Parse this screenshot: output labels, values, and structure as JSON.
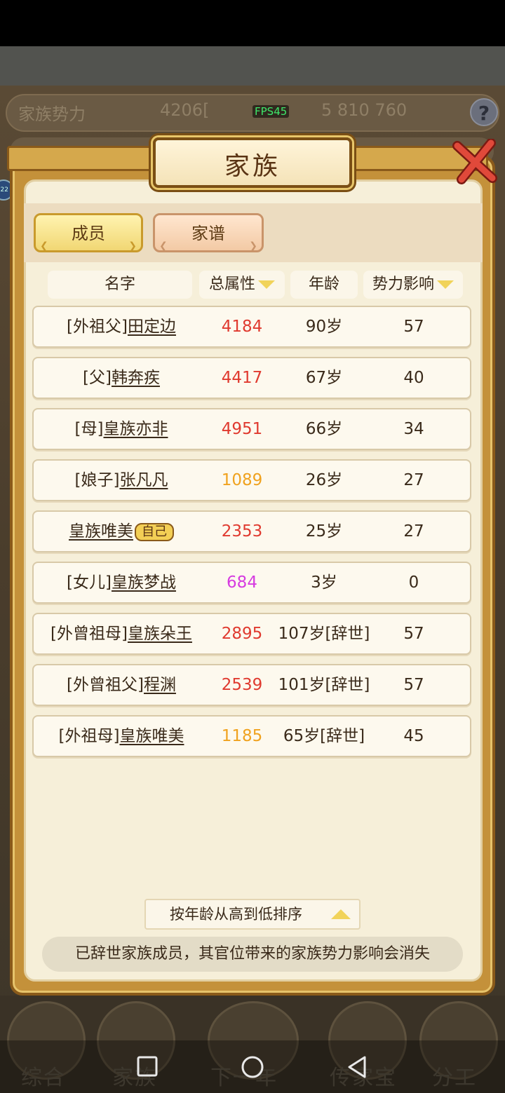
{
  "hud": {
    "title": "家族势力",
    "power": "4206[",
    "fps": "FPS45",
    "resources": "5 810 760"
  },
  "dialog": {
    "title": "家族",
    "tabs": [
      "成员",
      "家谱"
    ]
  },
  "table": {
    "headers": [
      "名字",
      "总属性",
      "年龄",
      "势力影响"
    ],
    "rows": [
      {
        "prefix": "[外祖父]",
        "name": "田定边",
        "attr": "4184",
        "attr_color": "#e03a2f",
        "age": "90岁",
        "power": "57"
      },
      {
        "prefix": "[父]",
        "name": "韩奔疾",
        "attr": "4417",
        "attr_color": "#e03a2f",
        "age": "67岁",
        "power": "40"
      },
      {
        "prefix": "[母]",
        "name": "皇族亦非",
        "attr": "4951",
        "attr_color": "#e03a2f",
        "age": "66岁",
        "power": "34"
      },
      {
        "prefix": "[娘子]",
        "name": "张凡凡",
        "attr": "1089",
        "attr_color": "#f0a21e",
        "age": "26岁",
        "power": "27"
      },
      {
        "prefix": "",
        "name": "皇族唯美",
        "self_tag": "自己",
        "attr": "2353",
        "attr_color": "#e03a2f",
        "age": "25岁",
        "power": "27"
      },
      {
        "prefix": "[女儿]",
        "name": "皇族梦战",
        "attr": "684",
        "attr_color": "#d63be0",
        "age": "3岁",
        "power": "0"
      },
      {
        "prefix": "[外曾祖母]",
        "name": "皇族朵王",
        "attr": "2895",
        "attr_color": "#e03a2f",
        "age": "107岁[辞世]",
        "power": "57"
      },
      {
        "prefix": "[外曾祖父]",
        "name": "程渊",
        "attr": "2539",
        "attr_color": "#e03a2f",
        "age": "101岁[辞世]",
        "power": "57"
      },
      {
        "prefix": "[外祖母]",
        "name": "皇族唯美",
        "attr": "1185",
        "attr_color": "#f0a21e",
        "age": "65岁[辞世]",
        "power": "45"
      }
    ]
  },
  "sort_label": "按年龄从高到低排序",
  "note": "已辞世家族成员，其官位带来的家族势力影响会消失",
  "bottom_menu": [
    "综合",
    "家族",
    "下一年",
    "传家宝",
    "分工"
  ],
  "colors": {
    "attr_red": "#e03a2f",
    "attr_orange": "#f0a21e",
    "attr_purple": "#d63be0",
    "panel_bg": "#f6efd9",
    "frame_gold": "#c4913a"
  }
}
